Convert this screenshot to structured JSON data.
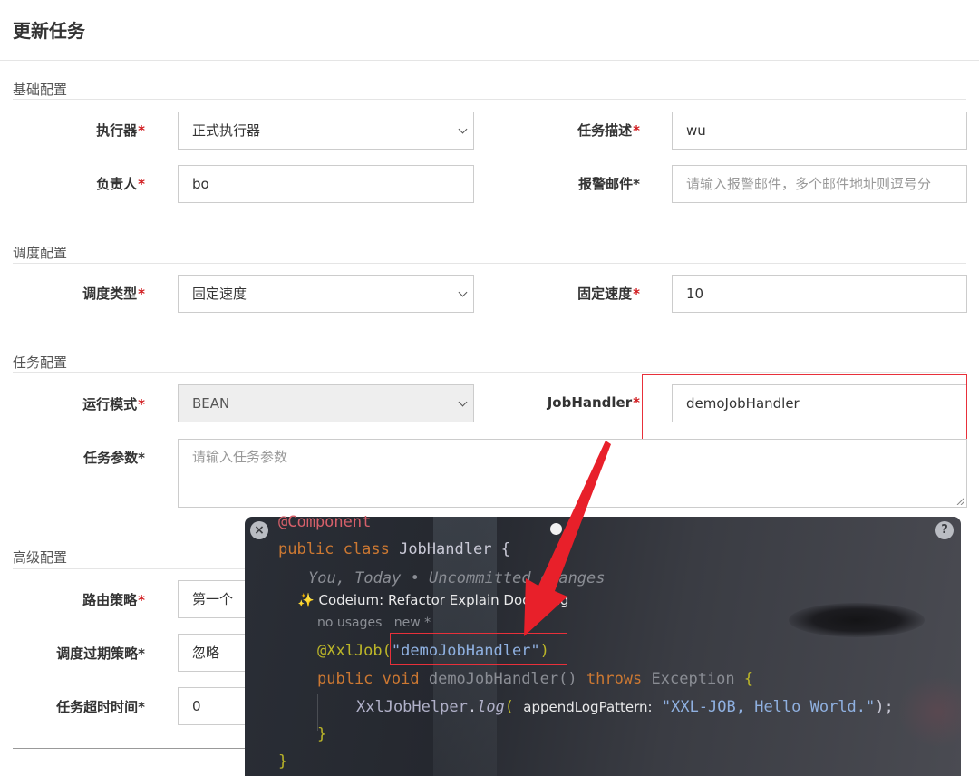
{
  "modal": {
    "title": "更新任务"
  },
  "sections": {
    "basic": "基础配置",
    "schedule": "调度配置",
    "task": "任务配置",
    "advanced": "高级配置"
  },
  "fields": {
    "executor": {
      "label": "执行器",
      "value": "正式执行器"
    },
    "job_desc": {
      "label": "任务描述",
      "value": "wu"
    },
    "owner": {
      "label": "负责人",
      "value": "bo"
    },
    "alarm_email": {
      "label": "报警邮件",
      "placeholder": "请输入报警邮件，多个邮件地址则逗号分"
    },
    "schedule_type": {
      "label": "调度类型",
      "value": "固定速度"
    },
    "fixed_rate": {
      "label": "固定速度",
      "value": "10"
    },
    "run_mode": {
      "label": "运行模式",
      "value": "BEAN"
    },
    "job_handler": {
      "label": "JobHandler",
      "value": "demoJobHandler"
    },
    "job_param": {
      "label": "任务参数",
      "placeholder": "请输入任务参数"
    },
    "route_strategy": {
      "label": "路由策略",
      "value": "第一个"
    },
    "misfire_strategy": {
      "label": "调度过期策略",
      "value": "忽略"
    },
    "timeout": {
      "label": "任务超时时间",
      "value": "0"
    }
  },
  "required_mark": "*",
  "code_popup": {
    "close_icon": "×",
    "help_icon": "?",
    "line_annotation": "@Component",
    "line_class": {
      "kw": "public class",
      "name": "JobHandler",
      "brace": "{"
    },
    "line_blame": "You, Today • Uncommitted changes",
    "line_codeium": {
      "sparkle": "✨",
      "prefix": "Codeium:",
      "refactor": "Refactor",
      "explain": "Explain",
      "docstring": "Docstring"
    },
    "line_usages": {
      "usages": "no usages",
      "new": "new *"
    },
    "line_xxljob": {
      "ann": "@XxlJob(",
      "str": "\"demoJobHandler\"",
      "close": ")"
    },
    "line_method": {
      "kw": "public void",
      "name": "demoJobHandler()",
      "throws": "throws",
      "exc": "Exception",
      "brace": "{"
    },
    "line_log": {
      "cls": "XxlJobHelper",
      "dot": ".",
      "meth": "log",
      "paren": "(",
      "hint": "appendLogPattern:",
      "str": "\"XXL-JOB, Hello World.\"",
      "end": ");"
    },
    "line_close1": "}",
    "line_close2": "}"
  },
  "colors": {
    "required": "#d0171b",
    "highlight_box": "#e8303a",
    "arrow": "#e8202a"
  }
}
